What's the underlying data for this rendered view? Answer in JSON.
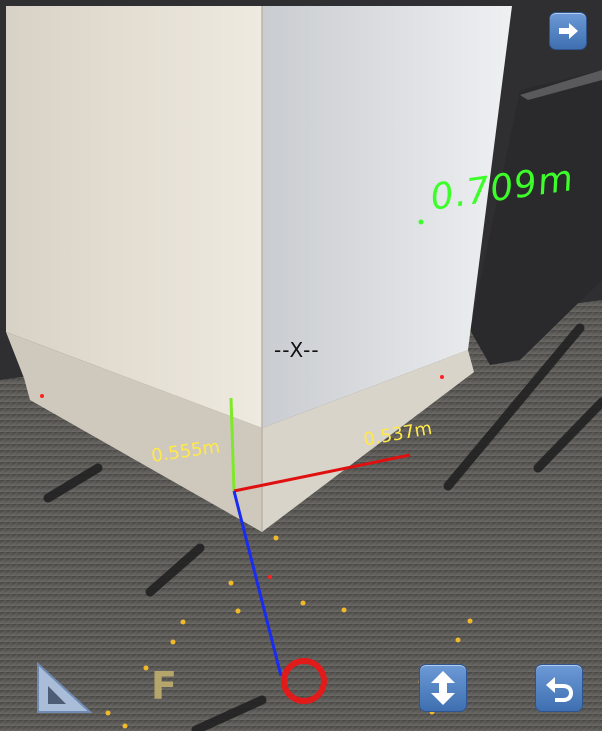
{
  "crosshair": {
    "text": "--X--"
  },
  "measurements": {
    "axis_x_length": "0.555m",
    "axis_z_length": "0.537m",
    "main_length": "0.709m"
  },
  "toolbar": {
    "focus_label": "F"
  },
  "icons": {
    "next": "arrow-right-icon",
    "ruler": "triangle-ruler-icon",
    "lift": "up-down-arrow-icon",
    "undo": "undo-icon",
    "capture": "ring-icon"
  },
  "colors": {
    "axis_x": "#e01010",
    "axis_y": "#7ee82a",
    "axis_z": "#1a2cf0",
    "measure_label": "#ffe94a",
    "main_label": "#3cff2a",
    "point_marker": "#f2b92a",
    "capture_ring": "#e11a1a",
    "button_blue": "#4f7fc2"
  }
}
